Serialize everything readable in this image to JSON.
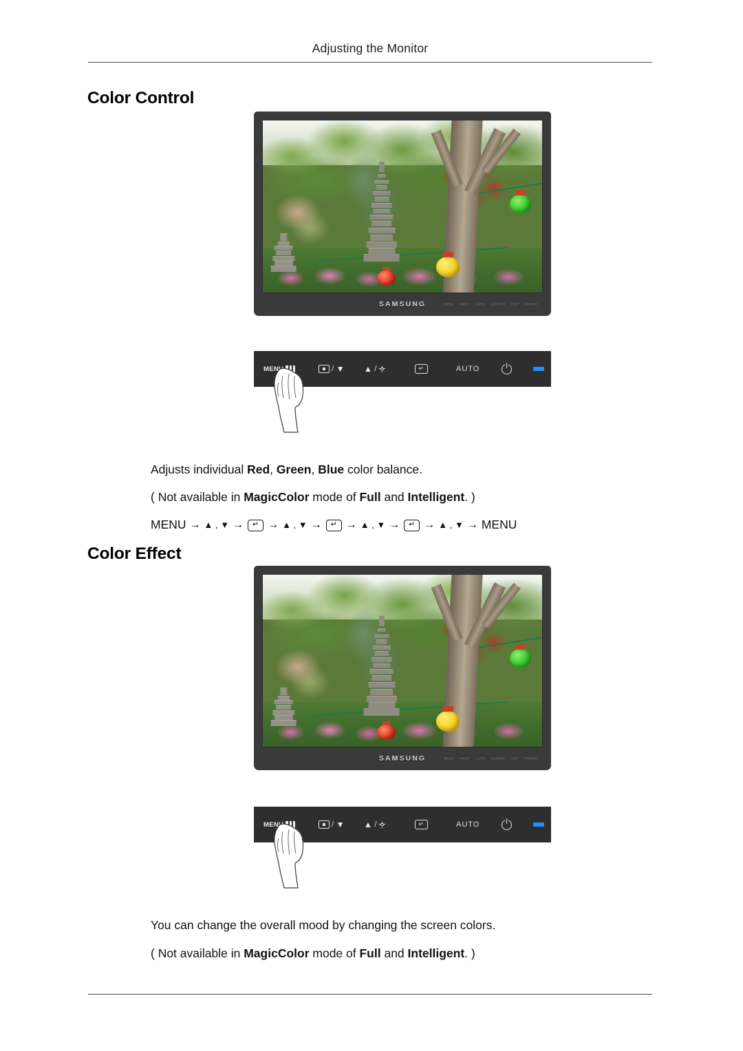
{
  "header": {
    "running_title": "Adjusting the Monitor"
  },
  "sections": [
    {
      "heading": "Color Control",
      "monitor": {
        "brand": "SAMSUNG",
        "bezel_marks": [
          "MENU",
          "INPUT",
          "AUTO",
          "SOURCE",
          "EXIT",
          "POWER",
          "LED"
        ]
      },
      "control_panel": {
        "menu_label": "MENU",
        "auto_label": "AUTO",
        "icons": [
          "menu-lines-icon",
          "source-box-icon",
          "triangle-down-icon",
          "triangle-up-icon",
          "brightness-sun-icon",
          "enter-key-icon",
          "power-icon",
          "power-led-indicator"
        ],
        "led_color": "#1e90ff"
      },
      "body": {
        "line1_pre": "Adjusts individual ",
        "line1_b1": "Red",
        "line1_sep1": ", ",
        "line1_b2": "Green",
        "line1_sep2": ", ",
        "line1_b3": "Blue",
        "line1_post": " color balance.",
        "line2_pre": "( Not available in ",
        "line2_b1": "MagicColor",
        "line2_mid": " mode of ",
        "line2_b2": "Full",
        "line2_and": " and ",
        "line2_b3": "Intelligent",
        "line2_post": ". )",
        "sequence_start": "MENU",
        "sequence_end": "MENU",
        "sequence_updown": "▲ , ▼",
        "sequence_arrow": "→",
        "sequence_key": "↵"
      }
    },
    {
      "heading": "Color Effect",
      "monitor": {
        "brand": "SAMSUNG",
        "bezel_marks": [
          "MENU",
          "INPUT",
          "AUTO",
          "SOURCE",
          "EXIT",
          "POWER",
          "LED"
        ]
      },
      "control_panel": {
        "menu_label": "MENU",
        "auto_label": "AUTO",
        "led_color": "#1e90ff"
      },
      "body": {
        "line1": "You can change the overall mood by changing the screen colors.",
        "line2_pre": "( Not available in ",
        "line2_b1": "MagicColor",
        "line2_mid": " mode of ",
        "line2_b2": "Full",
        "line2_and": " and ",
        "line2_b3": "Intelligent",
        "line2_post": ". )"
      }
    }
  ]
}
